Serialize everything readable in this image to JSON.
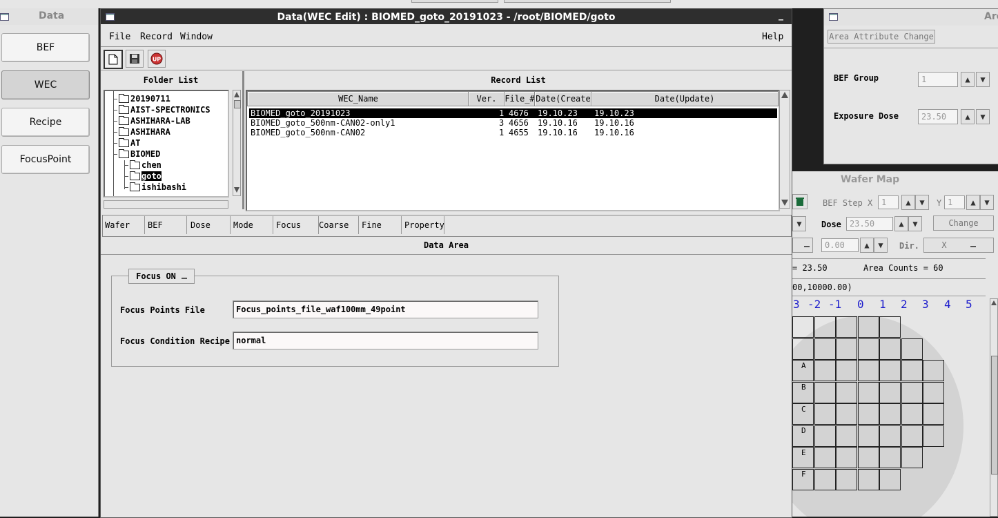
{
  "nav": {
    "title": "Data",
    "buttons": [
      "BEF",
      "WEC",
      "Recipe",
      "FocusPoint"
    ],
    "active": "WEC"
  },
  "main_window": {
    "title": "Data(WEC Edit) : BIOMED_goto_20191023 - /root/BIOMED/goto",
    "minimize_glyph": "_",
    "menus": [
      "File",
      "Record",
      "Window"
    ],
    "help": "Help",
    "toolbar_icons": [
      "new-document-icon",
      "save-icon",
      "upload-icon"
    ],
    "upload_label": "UP"
  },
  "folder_list": {
    "title": "Folder List",
    "items": [
      {
        "label": "20190711",
        "level": 0
      },
      {
        "label": "AIST-SPECTRONICS",
        "level": 0
      },
      {
        "label": "ASHIHARA-LAB",
        "level": 0
      },
      {
        "label": "ASHIHARA",
        "level": 0
      },
      {
        "label": "AT",
        "level": 0
      },
      {
        "label": "BIOMED",
        "level": 0,
        "open": true
      },
      {
        "label": "chen",
        "level": 1
      },
      {
        "label": "goto",
        "level": 1,
        "selected": true
      },
      {
        "label": "ishibashi",
        "level": 1
      }
    ]
  },
  "record_list": {
    "title": "Record List",
    "columns": [
      "WEC_Name",
      "Ver.",
      "File_#",
      "Date(Create",
      "Date(Update)"
    ],
    "rows": [
      {
        "name": "BIOMED_goto_20191023",
        "ver": "1",
        "file": "4676",
        "created": "19.10.23",
        "updated": "19.10.23",
        "selected": true
      },
      {
        "name": "BIOMED_goto_500nm-CAN02-only1",
        "ver": "3",
        "file": "4656",
        "created": "19.10.16",
        "updated": "19.10.16"
      },
      {
        "name": "BIOMED_goto_500nm-CAN02",
        "ver": "1",
        "file": "4655",
        "created": "19.10.16",
        "updated": "19.10.16"
      }
    ]
  },
  "tabs": [
    "Wafer",
    "BEF",
    "Dose",
    "Mode",
    "Focus",
    "Coarse",
    "Fine",
    "Property"
  ],
  "active_tab": "Focus",
  "data_area": {
    "title": "Data Area",
    "focus_toggle": "Focus ON",
    "focus_points_label": "Focus Points File",
    "focus_points_value": "Focus_points_file_waf100mm_49point",
    "focus_recipe_label": "Focus Condition Recipe",
    "focus_recipe_value": "normal"
  },
  "area_window": {
    "title": "Are",
    "attr_button": "Area Attribute Change",
    "bef_group_label": "BEF Group",
    "bef_group_value": "1",
    "exposure_label": "Exposure Dose",
    "exposure_value": "23.50"
  },
  "wafer_map": {
    "title": "Wafer Map",
    "bef_step_label": "BEF Step X",
    "step_x": "1",
    "y_label": "Y",
    "step_y": "1",
    "dose_label": "Dose",
    "dose_value": "23.50",
    "change_button": "Change",
    "offset_value": "0.00",
    "dir_label": "Dir.",
    "dir_value": "X",
    "info_dose": "= 23.50",
    "area_counts": "Area Counts = 60",
    "coords": "00,10000.00)",
    "col_labels": [
      "3",
      "-2",
      "-1",
      "0",
      "1",
      "2",
      "3",
      "4",
      "5"
    ],
    "row_labels": [
      "A",
      "B",
      "C",
      "D",
      "E",
      "F"
    ],
    "accent_color": "#1a1acc"
  }
}
